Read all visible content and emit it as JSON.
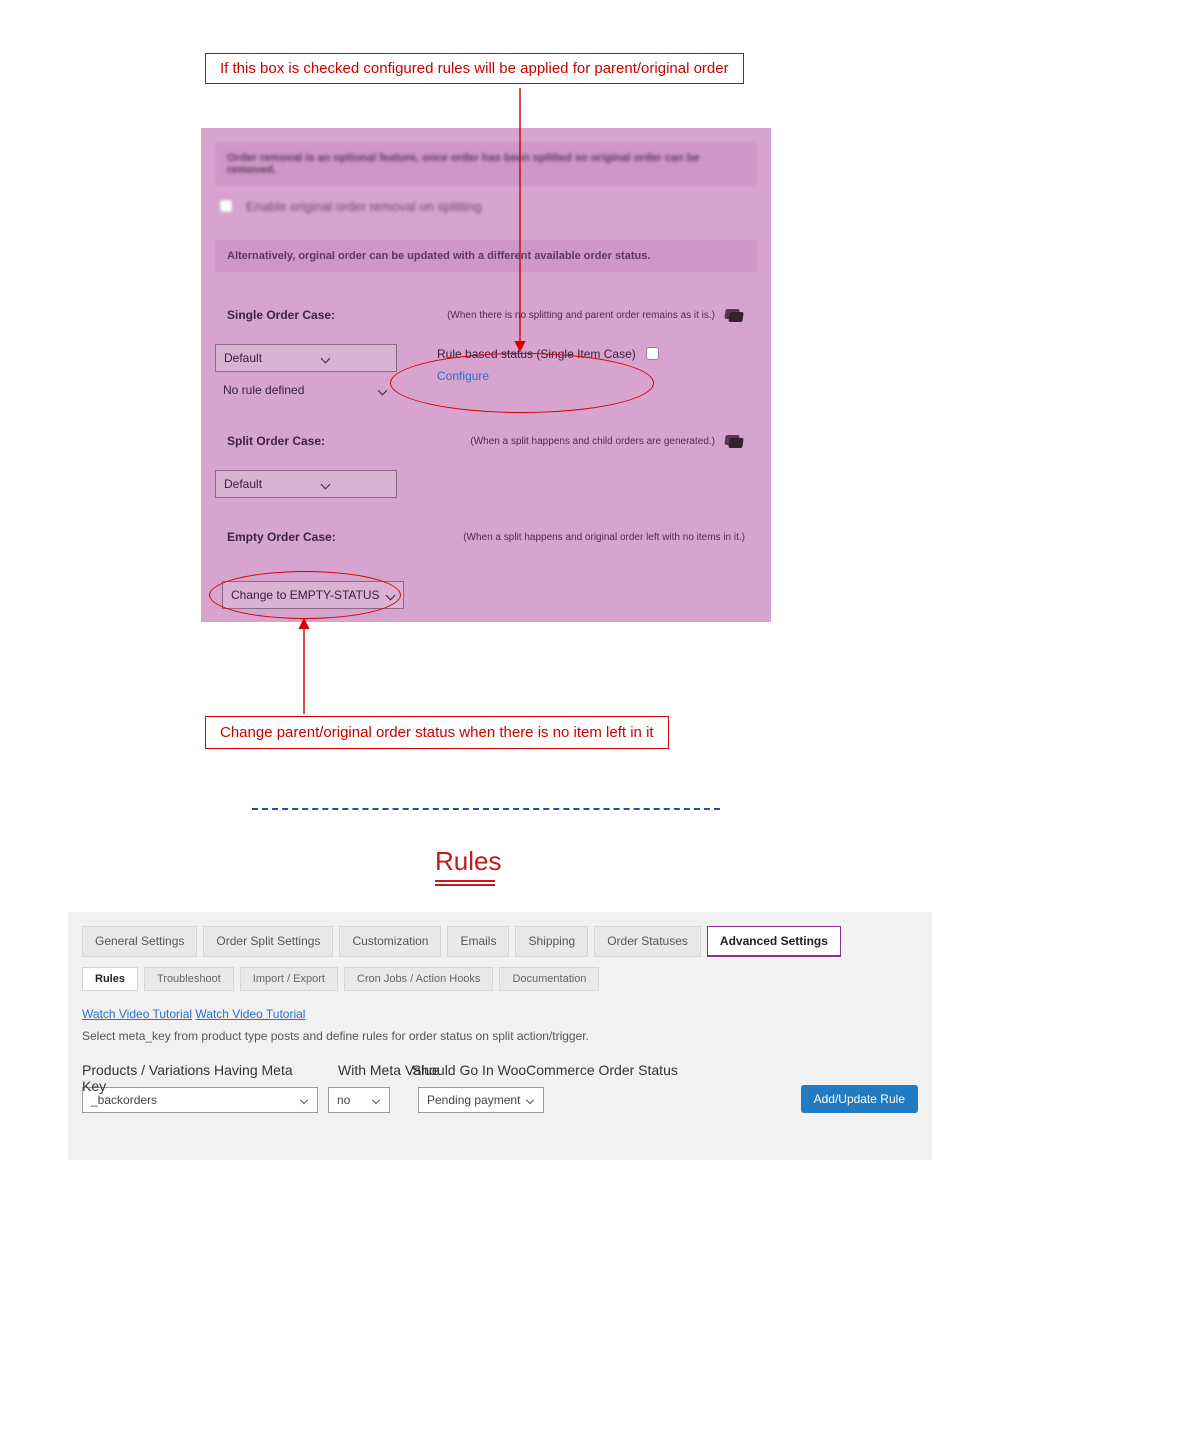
{
  "callouts": {
    "top": "If this box is checked configured rules will be applied for parent/original order",
    "bottom": "Change parent/original order status when there is no item left in it"
  },
  "panel": {
    "banner1": "Order removal is an optional feature, once order has been splitted so original order can be removed.",
    "enable_removal_label": "Enable original order removal on splitting",
    "banner2": "Alternatively, orginal order can be updated with a different available order status.",
    "single": {
      "title": "Single Order Case:",
      "hint": "(When there is no splitting and parent order remains as it is.)",
      "select_value": "Default",
      "no_rule_label": "No rule defined",
      "rule_checkbox_label": "Rule based status (Single Item Case)",
      "configure": "Configure"
    },
    "split": {
      "title": "Split Order Case:",
      "hint": "(When a split happens and child orders are generated.)",
      "select_value": "Default"
    },
    "empty": {
      "title": "Empty Order Case:",
      "hint": "(When a split happens and original order left with no items in it.)",
      "select_value": "Change to EMPTY-STATUS"
    }
  },
  "rules_heading": "Rules",
  "admin": {
    "tabs": [
      "General Settings",
      "Order Split Settings",
      "Customization",
      "Emails",
      "Shipping",
      "Order Statuses",
      "Advanced Settings"
    ],
    "active_tab_index": 6,
    "subtabs": [
      "Rules",
      "Troubleshoot",
      "Import / Export",
      "Cron Jobs / Action Hooks",
      "Documentation"
    ],
    "active_subtab_index": 0,
    "link1": "Watch Video Tutorial",
    "link2": "Watch Video Tutorial",
    "desc": "Select meta_key from product type posts and define rules for order status on split action/trigger.",
    "col1_label": "Products / Variations Having Meta Key",
    "col1_value": "_backorders",
    "col2_label": "With Meta Value",
    "col2_value": "no",
    "col3_label": "Should Go In WooCommerce Order Status",
    "col3_value": "Pending payment",
    "button": "Add/Update Rule"
  }
}
